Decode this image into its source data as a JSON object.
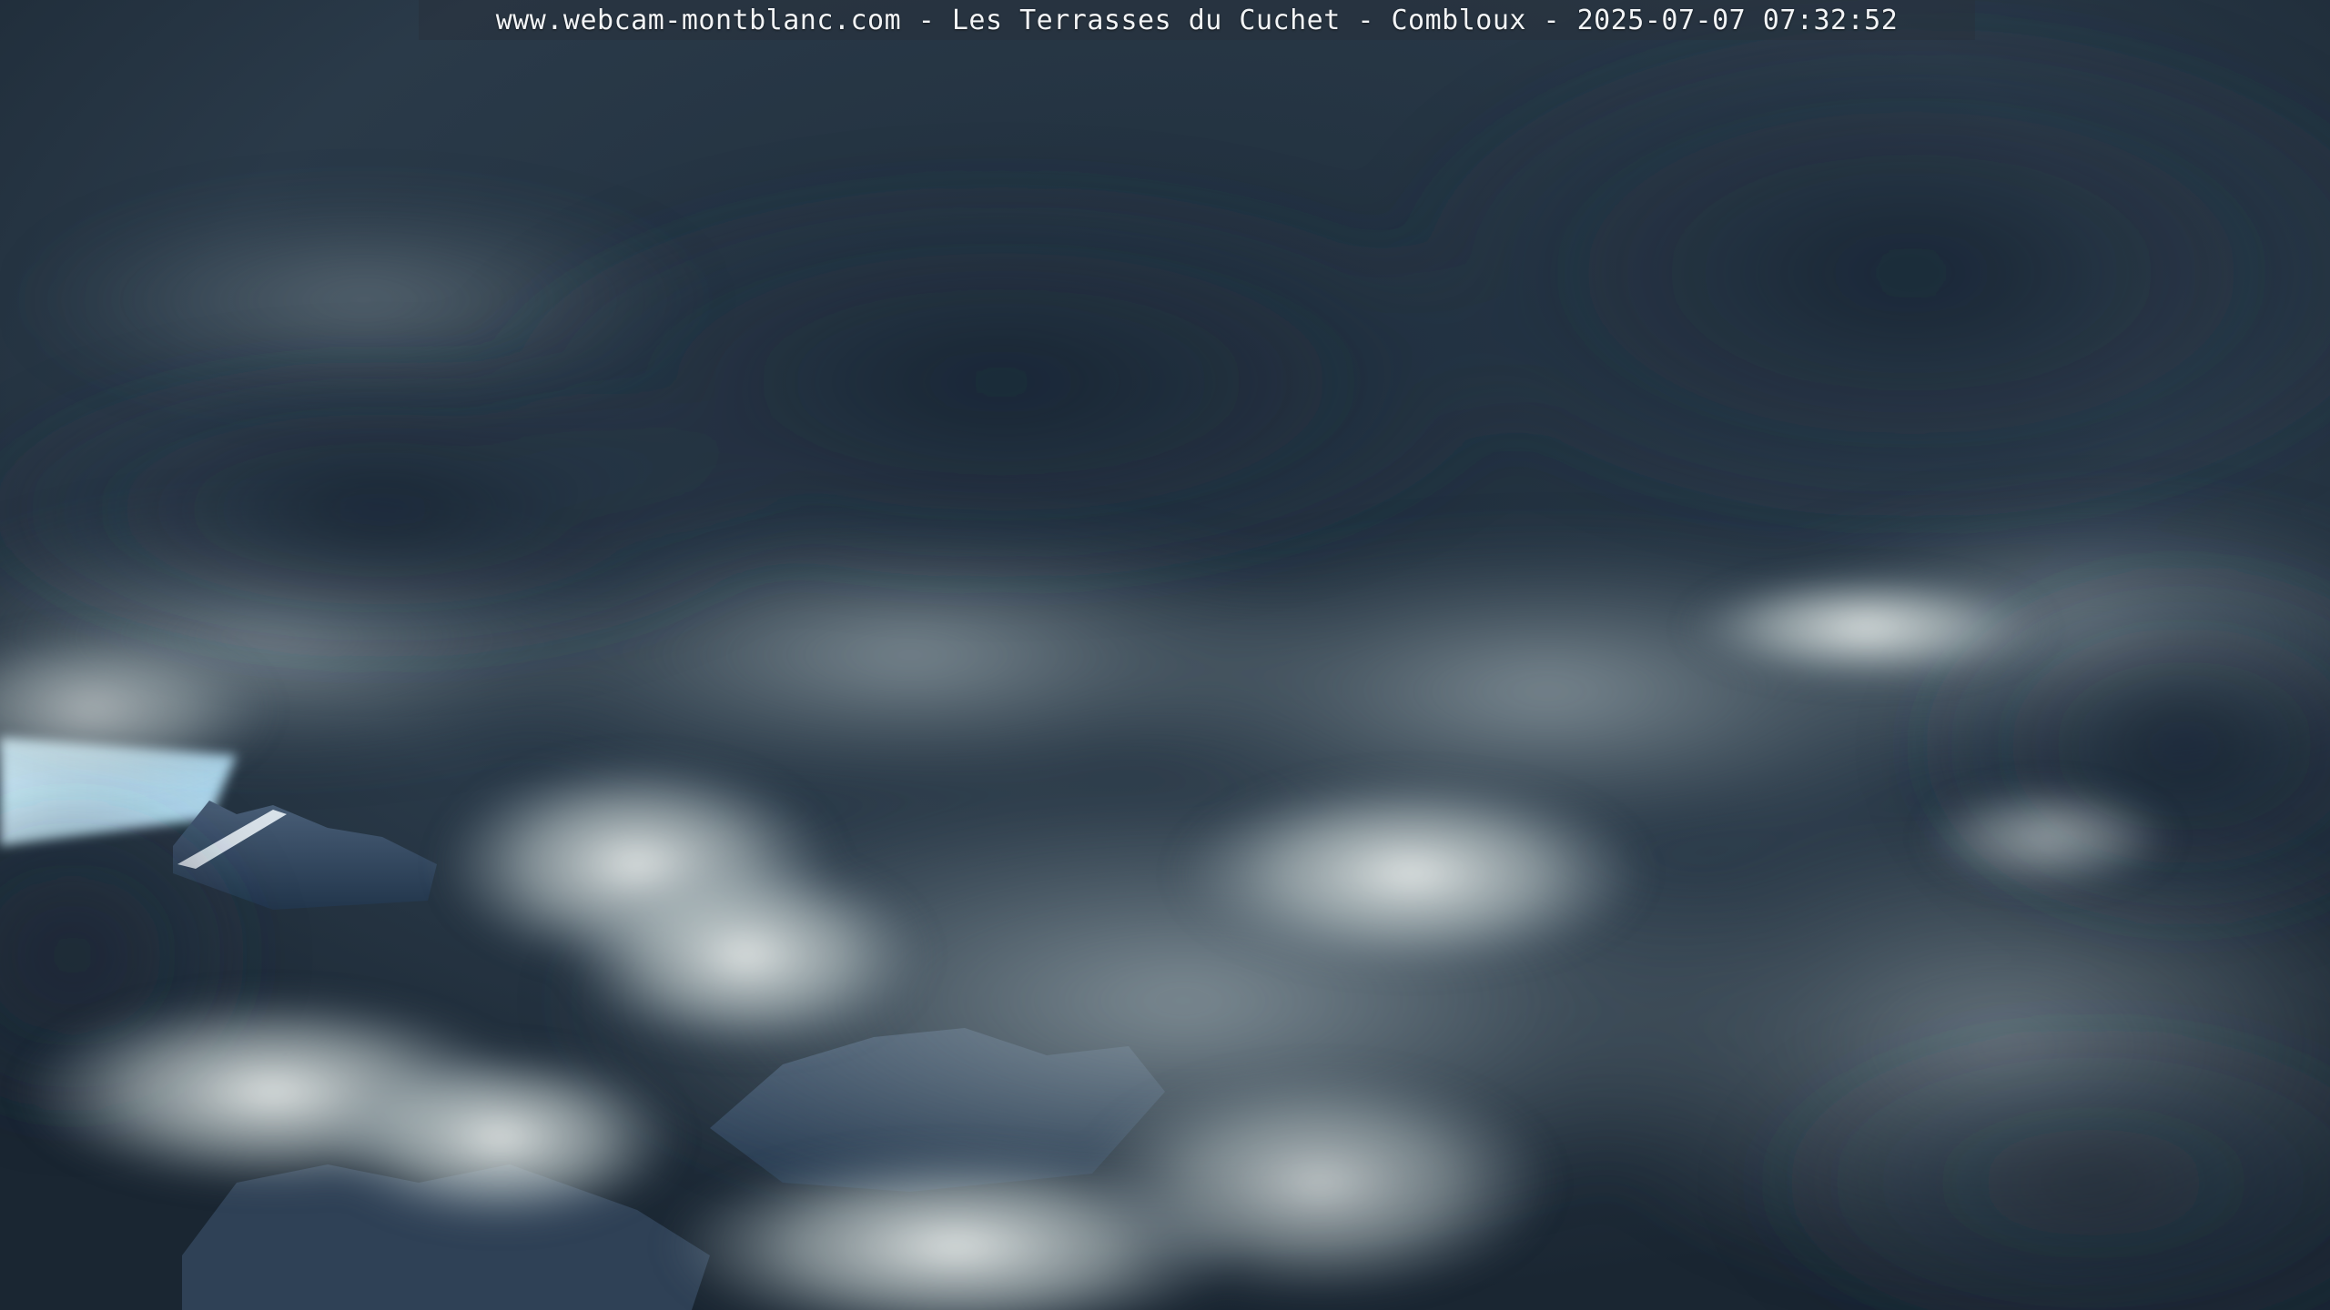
{
  "overlay": {
    "caption": "www.webcam-montblanc.com - Les Terrasses du Cuchet - Combloux - 2025-07-07 07:32:52"
  },
  "scene": {
    "description_colors": {
      "dark_cloud": "#223140",
      "mid_cloud": "#56666f",
      "light_cloud": "#dfe6e6",
      "blue_sky": "#bfe2f2",
      "rock": "#2c3e52"
    }
  }
}
